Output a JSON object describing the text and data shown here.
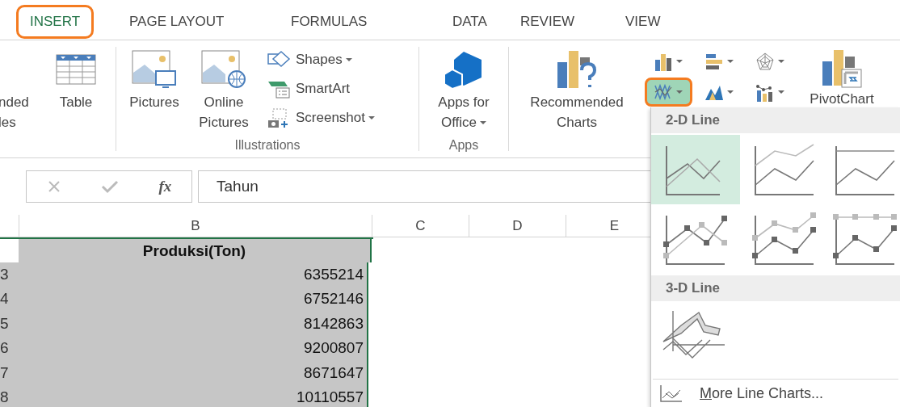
{
  "tabs": [
    {
      "label": "INSERT",
      "selected": true
    },
    {
      "label": "PAGE LAYOUT",
      "selected": false
    },
    {
      "label": "FORMULAS",
      "selected": false
    },
    {
      "label": "DATA",
      "selected": false
    },
    {
      "label": "REVIEW",
      "selected": false
    },
    {
      "label": "VIEW",
      "selected": false
    }
  ],
  "ribbon": {
    "partial_button": {
      "lines": [
        "nded",
        "les"
      ]
    },
    "table_button": {
      "label": "Table"
    },
    "illustrations": {
      "pictures": {
        "lines": [
          "Pictures"
        ]
      },
      "online_pictures": {
        "lines": [
          "Online",
          "Pictures"
        ]
      },
      "small_buttons": [
        {
          "kind": "shapes",
          "label": "Shapes",
          "dropdown": true
        },
        {
          "kind": "smartart",
          "label": "SmartArt",
          "dropdown": false
        },
        {
          "kind": "screenshot",
          "label": "Screenshot",
          "dropdown": true
        }
      ],
      "group_label": "Illustrations"
    },
    "apps": {
      "lines": [
        "Apps for",
        "Office"
      ],
      "dropdown": true,
      "group_label": "Apps"
    },
    "charts": {
      "recommended": {
        "lines": [
          "Recommended",
          "Charts"
        ]
      },
      "chart_buttons": [
        {
          "kind": "column",
          "selected": false
        },
        {
          "kind": "bar",
          "selected": false
        },
        {
          "kind": "radar",
          "selected": false
        },
        {
          "kind": "line",
          "selected": true
        },
        {
          "kind": "area",
          "selected": false
        },
        {
          "kind": "scatter",
          "selected": false
        }
      ],
      "pivot_chart": {
        "label": "PivotChart"
      }
    }
  },
  "formula_bar": {
    "function_label": "fx",
    "value": "Tahun"
  },
  "sheet": {
    "columns": [
      "B",
      "C",
      "D",
      "E"
    ],
    "rows": [
      {
        "kind": "header",
        "value": "Produksi(Ton)"
      },
      {
        "kind": "data",
        "number": "3",
        "value": "6355214"
      },
      {
        "kind": "data",
        "number": "4",
        "value": "6752146"
      },
      {
        "kind": "data",
        "number": "5",
        "value": "8142863"
      },
      {
        "kind": "data",
        "number": "6",
        "value": "9200807"
      },
      {
        "kind": "data",
        "number": "7",
        "value": "8671647"
      },
      {
        "kind": "data",
        "number": "8",
        "value": "10110557"
      }
    ]
  },
  "line_menu": {
    "sections": [
      {
        "title": "2-D Line",
        "items": [
          {
            "kind": "line",
            "selected": true
          },
          {
            "kind": "stacked",
            "selected": false
          },
          {
            "kind": "percent",
            "selected": false
          },
          {
            "kind": "line-markers",
            "selected": false
          },
          {
            "kind": "stacked-markers",
            "selected": false
          },
          {
            "kind": "percent-markers",
            "selected": false
          }
        ]
      },
      {
        "title": "3-D Line",
        "items": [
          {
            "kind": "perspective",
            "selected": false
          }
        ]
      }
    ],
    "more_link": "More Line Charts..."
  }
}
